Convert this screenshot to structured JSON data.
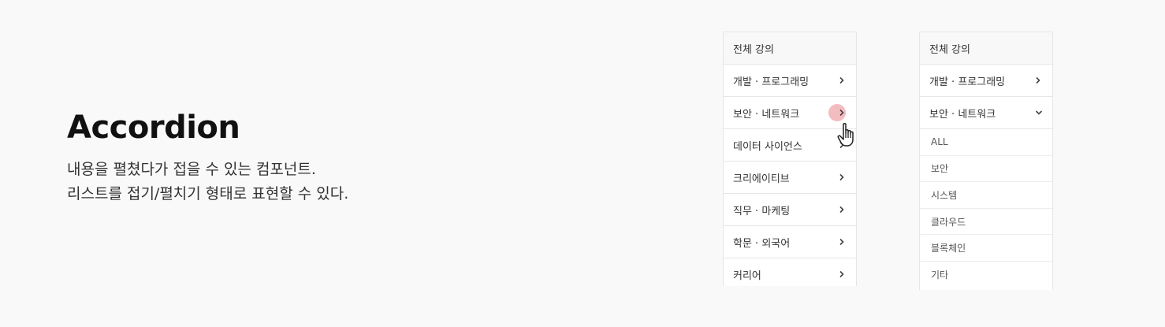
{
  "intro": {
    "title": "Accordion",
    "line1": "내용을 펼쳤다가 접을 수 있는 컴포넌트.",
    "line2": "리스트를 접기/펼치기 형태로 표현할 수 있다."
  },
  "panel_collapsed": {
    "header": "전체 강의",
    "items": [
      "개발 · 프로그래밍",
      "보안 · 네트워크",
      "데이터 사이언스",
      "크리에이티브",
      "직무 · 마케팅",
      "학문 · 외국어",
      "커리어"
    ]
  },
  "panel_expanded": {
    "header": "전체 강의",
    "items": [
      "개발 · 프로그래밍",
      "보안 · 네트워크"
    ],
    "sub_items": [
      "ALL",
      "보안",
      "시스템",
      "클라우드",
      "블록체인",
      "기타"
    ]
  },
  "colors": {
    "cursor_dot": "#ec9a9c"
  }
}
